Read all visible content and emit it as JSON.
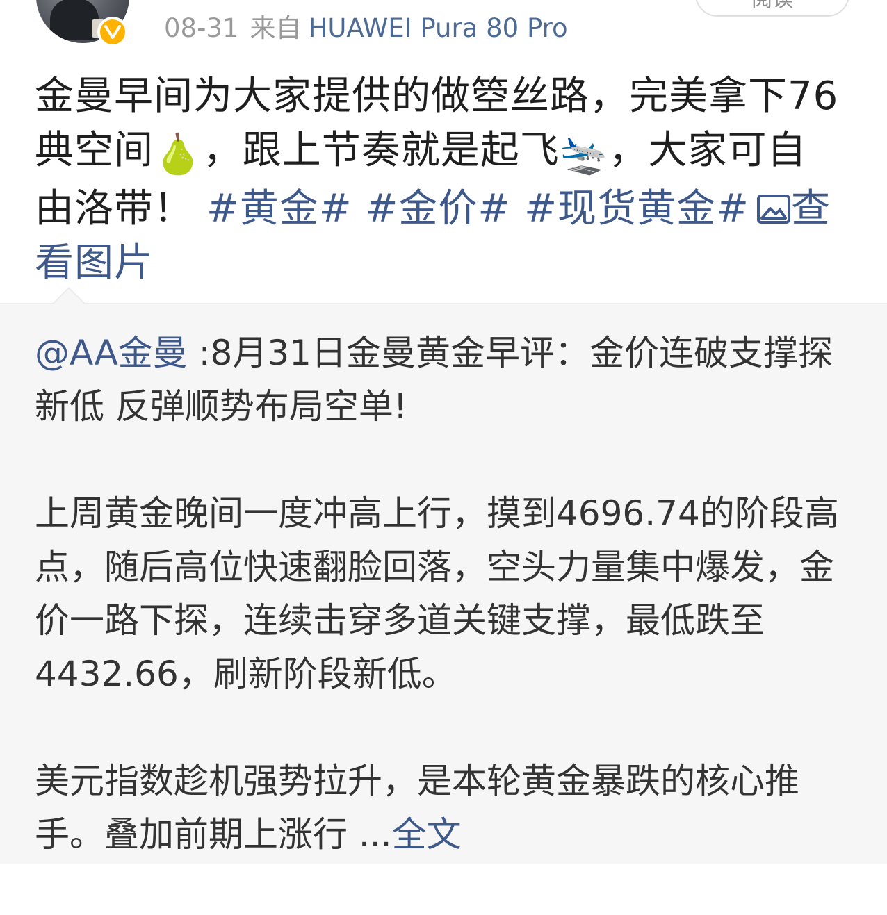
{
  "header": {
    "date": "08-31",
    "from_label": "来自",
    "device": "HUAWEI Pura 80 Pro",
    "read_label": "阅读"
  },
  "post": {
    "text_1": "金曼早间为大家提供的做箜丝路，完美拿下76典空间",
    "emoji_1": "🍐",
    "text_2": "，跟上节奏就是起飞",
    "emoji_2": "🛬",
    "text_3": "，大家可自由洛带！ ",
    "topics": [
      "#黄金#",
      "#金价#",
      "#现货黄金#"
    ],
    "view_pic_label": "查看图片",
    "icon_pic": "image-icon"
  },
  "repost": {
    "mention": "@AA金曼",
    "headline": " :8月31日金曼黄金早评：金价连破支撑探新低 反弹顺势布局空单!",
    "paragraph_1": "上周黄金晚间一度冲高上行，摸到4696.74的阶段高点，随后高位快速翻脸回落，空头力量集中爆发，金价一路下探，连续击穿多道关键支撑，最低跌至4432.66，刷新阶段新低。",
    "paragraph_2": "美元指数趁机强势拉升，是本轮黄金暴跌的核心推手。叠加前期上涨行 ...",
    "full_text_label": "全文"
  },
  "colors": {
    "link": "#3f5a8a",
    "meta": "#9a9a9a",
    "badge": "#ffb300",
    "panel_bg": "#f6f6f6"
  }
}
